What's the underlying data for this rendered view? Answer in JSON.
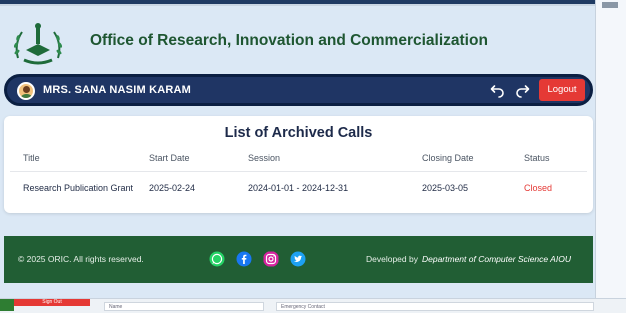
{
  "header": {
    "site_title": "Office of Research, Innovation and Commercialization"
  },
  "navbar": {
    "user_name": "MRS. SANA NASIM KARAM",
    "logout_label": "Logout"
  },
  "archived_calls": {
    "title": "List of Archived Calls",
    "columns": [
      "Title",
      "Start Date",
      "Session",
      "Closing Date",
      "Status"
    ],
    "rows": [
      {
        "title": "Research Publication Grant",
        "start_date": "2025-02-24",
        "session": "2024-01-01 - 2024-12-31",
        "closing_date": "2025-03-05",
        "status": "Closed"
      }
    ]
  },
  "footer": {
    "copyright": "© 2025 ORIC. All rights reserved.",
    "developed_by": "Developed by",
    "department": "Department of Computer Science AIOU"
  },
  "bottom_strip": {
    "button_label": "Sign Out",
    "field1_label": "Name",
    "field2_label": "Emergency Contact"
  },
  "colors": {
    "navbar_bg": "#1f3564",
    "logout_bg": "#e53935",
    "footer_bg": "#215e34",
    "title_green": "#1e5631",
    "status_closed": "#e53935"
  }
}
